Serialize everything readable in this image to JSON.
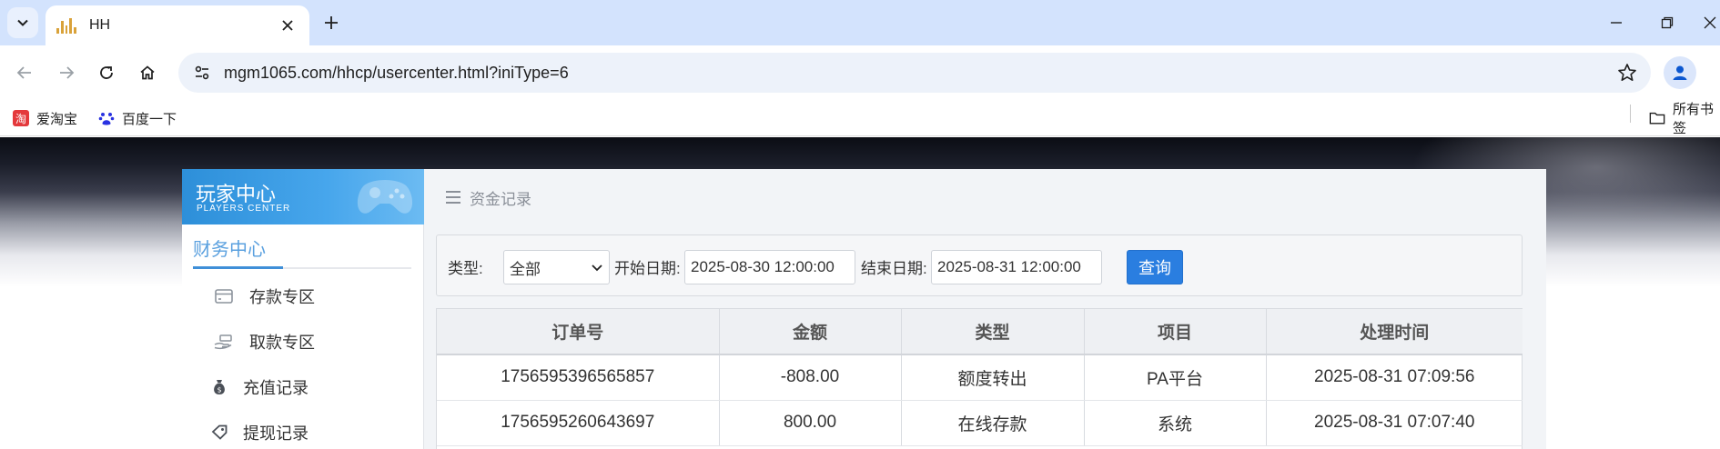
{
  "browser": {
    "tab_title": "HH",
    "url": "mgm1065.com/hhcp/usercenter.html?iniType=6",
    "bookmarks": [
      {
        "label": "爱淘宝",
        "icon": "aitaobao-icon"
      },
      {
        "label": "百度一下",
        "icon": "baidu-paw-icon"
      }
    ],
    "all_bookmarks_label": "所有书签"
  },
  "sidebar": {
    "title": "玩家中心",
    "subtitle": "PLAYERS CENTER",
    "section": "财务中心",
    "items": [
      {
        "label": "存款专区",
        "icon": "deposit-card-icon"
      },
      {
        "label": "取款专区",
        "icon": "withdraw-hand-icon"
      },
      {
        "label": "充值记录",
        "icon": "money-bag-icon"
      },
      {
        "label": "提现记录",
        "icon": "tag-icon"
      }
    ]
  },
  "content": {
    "breadcrumb": "资金记录",
    "filter": {
      "type_label": "类型:",
      "type_value": "全部",
      "start_label": "开始日期:",
      "start_value": "2025-08-30 12:00:00",
      "end_label": "结束日期:",
      "end_value": "2025-08-31 12:00:00",
      "query_label": "查询"
    },
    "table": {
      "headers": [
        "订单号",
        "金额",
        "类型",
        "项目",
        "处理时间"
      ],
      "rows": [
        [
          "1756595396565857",
          "-808.00",
          "额度转出",
          "PA平台",
          "2025-08-31 07:09:56"
        ],
        [
          "1756595260643697",
          "800.00",
          "在线存款",
          "系统",
          "2025-08-31 07:07:40"
        ]
      ]
    }
  },
  "colors": {
    "accent": "#2a7ee0",
    "sidebar_banner": "#3a9be4",
    "tabstrip": "#d3e3fd"
  }
}
